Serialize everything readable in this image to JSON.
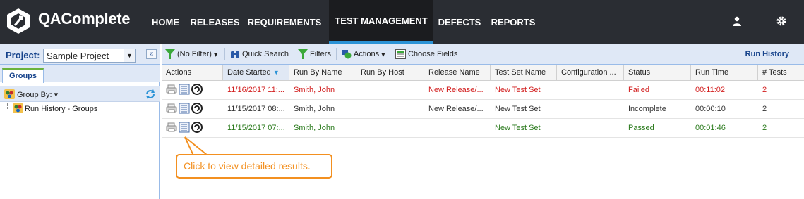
{
  "app": {
    "brand": "QAComplete",
    "nav": [
      "HOME",
      "RELEASES",
      "REQUIREMENTS",
      "TEST MANAGEMENT",
      "DEFECTS",
      "REPORTS"
    ],
    "active_nav": "TEST MANAGEMENT"
  },
  "left": {
    "project_label": "Project:",
    "project_value": "Sample Project",
    "tab": "Groups",
    "group_by": "Group By:",
    "tree_item": "Run History - Groups"
  },
  "toolbar": {
    "filter": "(No Filter)",
    "quick_search": "Quick Search",
    "filters": "Filters",
    "actions": "Actions",
    "choose_fields": "Choose Fields",
    "view_title": "Run History"
  },
  "grid": {
    "columns": [
      "Actions",
      "Date Started",
      "Run By Name",
      "Run By Host",
      "Release Name",
      "Test Set Name",
      "Configuration ...",
      "Status",
      "Run Time",
      "# Tests"
    ],
    "rows": [
      {
        "date": "11/16/2017 11:...",
        "run_by": "Smith, John",
        "host": "",
        "release": "New Release/...",
        "test_set": "New Test Set",
        "config": "",
        "status": "Failed",
        "run_time": "00:11:02",
        "tests": "2",
        "tone": "red"
      },
      {
        "date": "11/15/2017 08:...",
        "run_by": "Smith, John",
        "host": "",
        "release": "New Release/...",
        "test_set": "New Test Set",
        "config": "",
        "status": "Incomplete",
        "run_time": "00:00:10",
        "tests": "2",
        "tone": "dark"
      },
      {
        "date": "11/15/2017 07:...",
        "run_by": "Smith, John",
        "host": "",
        "release": "",
        "test_set": "New Test Set",
        "config": "",
        "status": "Passed",
        "run_time": "00:01:46",
        "tests": "2",
        "tone": "green"
      }
    ]
  },
  "callout": "Click to view detailed results.",
  "colors": {
    "nav_bg": "#2a2d33",
    "accent": "#2b93d6",
    "failed": "#d21e1e",
    "passed": "#2a7a1c",
    "callout": "#f39020"
  }
}
